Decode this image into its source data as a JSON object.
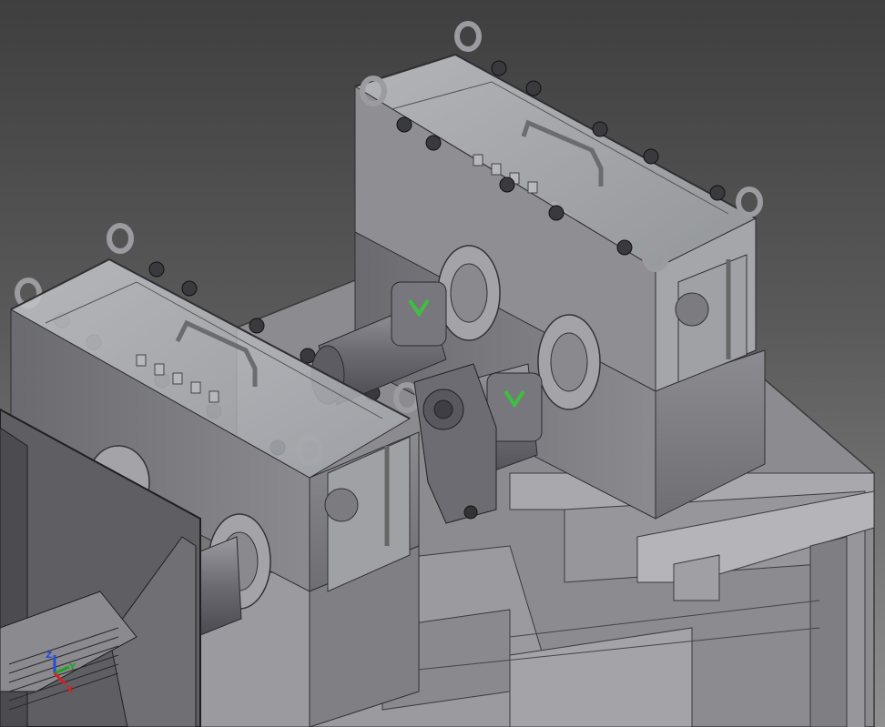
{
  "viewport": {
    "background_top": "#3f3f3f",
    "background_bottom": "#8f8f8f"
  },
  "view_cube_triad": {
    "icon": "xyz-axis-triad-icon",
    "axes": [
      {
        "label": "Z",
        "color": "#2b4bd6"
      },
      {
        "label": "Y",
        "color": "#1fa31f"
      },
      {
        "label": "X",
        "color": "#d61f1f"
      }
    ]
  },
  "model": {
    "description_icons": [
      "gearbox-icon",
      "coupling-icon",
      "eye-bolt-icon",
      "flange-icon",
      "frame-icon"
    ],
    "colors": {
      "metal_dark": "#5b5b60",
      "metal_mid": "#7d7d82",
      "metal_light": "#a9a9ae",
      "glass": "#b9bcc0",
      "coupling_insert": "#3fbf3f"
    }
  }
}
